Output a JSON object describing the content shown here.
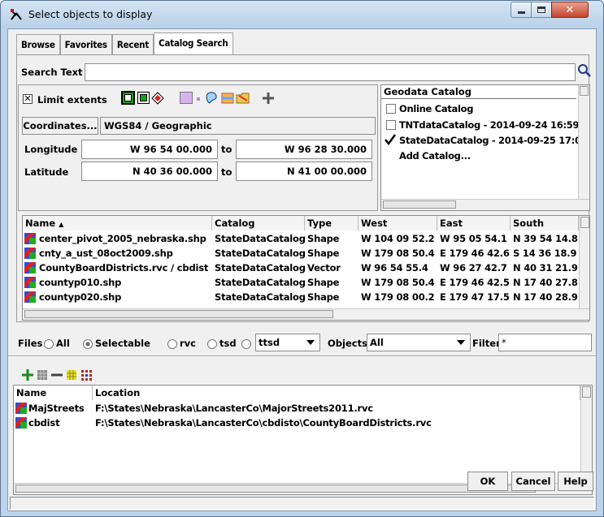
{
  "window": {
    "title": "Select objects to display"
  },
  "tabs": [
    "Browse",
    "Favorites",
    "Recent",
    "Catalog Search"
  ],
  "search": {
    "label": "Search Text",
    "value": ""
  },
  "extents": {
    "checkbox_label": "Limit extents",
    "checked": true,
    "coordinates_button": "Coordinates...",
    "coordinate_system": "WGS84 / Geographic",
    "longitude_label": "Longitude",
    "longitude_from": "W 96 54 00.000",
    "longitude_to": "W 96 28 30.000",
    "latitude_label": "Latitude",
    "latitude_from": "N 40 36 00.000",
    "latitude_to": "N 41 00 00.000",
    "to_label": "to"
  },
  "geodata_catalog": {
    "header": "Geodata Catalog",
    "items": [
      {
        "label": "Online Catalog",
        "checked": false
      },
      {
        "label": "TNTdataCatalog - 2014-09-24 16:59:",
        "checked": false
      },
      {
        "label": "StateDataCatalog - 2014-09-25 17:0",
        "checked": true
      },
      {
        "label": "Add Catalog...",
        "checked": null
      }
    ]
  },
  "results": {
    "columns": [
      "Name",
      "Catalog",
      "Type",
      "West",
      "East",
      "South"
    ],
    "sort_indicator": "▲",
    "rows": [
      {
        "name": "center_pivot_2005_nebraska.shp",
        "catalog": "StateDataCatalog",
        "type": "Shape",
        "west": "W 104 09 52.2",
        "east": "W 95 05 54.1",
        "south": "N 39 54 14.8"
      },
      {
        "name": "cnty_a_ust_08oct2009.shp",
        "catalog": "StateDataCatalog",
        "type": "Shape",
        "west": "W 179 08 50.4",
        "east": "E 179 46 42.6",
        "south": "S 14 36 18.9"
      },
      {
        "name": "CountyBoardDistricts.rvc / cbdist",
        "catalog": "StateDataCatalog",
        "type": "Vector",
        "west": "W 96 54 55.4",
        "east": "W 96 27 42.7",
        "south": "N 40 31 21.9"
      },
      {
        "name": "countyp010.shp",
        "catalog": "StateDataCatalog",
        "type": "Shape",
        "west": "W 179 08 50.4",
        "east": "E 179 46 42.5",
        "south": "N 17 40 27.8"
      },
      {
        "name": "countyp020.shp",
        "catalog": "StateDataCatalog",
        "type": "Shape",
        "west": "W 179 08 00.2",
        "east": "E 179 47 17.5",
        "south": "N 17 40 28.9"
      }
    ]
  },
  "filters": {
    "files_label": "Files",
    "options": [
      "All",
      "Selectable",
      "rvc",
      "tsd",
      "ttsd"
    ],
    "selected": "Selectable",
    "objects_label": "Objects",
    "objects_value": "All",
    "filter_label": "Filter",
    "filter_value": "*"
  },
  "selected_list": {
    "columns": [
      "Name",
      "Location"
    ],
    "rows": [
      {
        "name": "MajStreets",
        "location": "F:\\States\\Nebraska\\LancasterCo\\MajorStreets2011.rvc"
      },
      {
        "name": "cbdist",
        "location": "F:\\States\\Nebraska\\LancasterCo\\cbdisto\\CountyBoardDistricts.rvc"
      }
    ]
  },
  "buttons": {
    "ok": "OK",
    "cancel": "Cancel",
    "help": "Help"
  }
}
